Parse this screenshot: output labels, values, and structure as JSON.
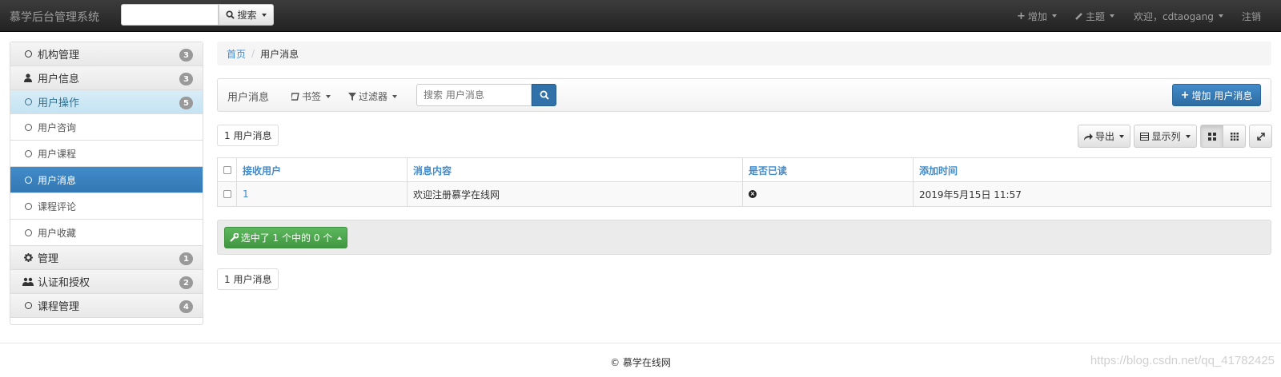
{
  "navbar": {
    "brand": "慕学后台管理系统",
    "search_value": "",
    "search_button": "搜索",
    "add_menu": "增加",
    "theme_menu": "主题",
    "user_menu": "欢迎，cdtaogang",
    "logout": "注销"
  },
  "sidebar": {
    "groups": [
      {
        "label": "机构管理",
        "badge": "3",
        "icon": "circle-icon"
      },
      {
        "label": "用户信息",
        "badge": "3",
        "icon": "user-icon"
      },
      {
        "label": "用户操作",
        "badge": "5",
        "icon": "circle-icon",
        "active": true
      },
      {
        "label": "管理",
        "badge": "1",
        "icon": "gear-icon"
      },
      {
        "label": "认证和授权",
        "badge": "2",
        "icon": "users-icon"
      },
      {
        "label": "课程管理",
        "badge": "4",
        "icon": "circle-icon"
      }
    ],
    "items": [
      {
        "label": "用户咨询"
      },
      {
        "label": "用户课程"
      },
      {
        "label": "用户消息",
        "selected": true
      },
      {
        "label": "课程评论"
      },
      {
        "label": "用户收藏"
      }
    ]
  },
  "breadcrumb": {
    "home": "首页",
    "separator": "/",
    "current": "用户消息"
  },
  "toolbar": {
    "title": "用户消息",
    "bookmarks": "书签",
    "filters": "过滤器",
    "search_placeholder": "搜索 用户消息",
    "add_button": "增加 用户消息"
  },
  "result_count_top": "1 用户消息",
  "result_count_bottom": "1 用户消息",
  "table_tools": {
    "export": "导出",
    "columns": "显示列"
  },
  "table": {
    "headers": [
      "接收用户",
      "消息内容",
      "是否已读",
      "添加时间"
    ],
    "rows": [
      {
        "user": "1",
        "message": "欢迎注册慕学在线网",
        "read": false,
        "time": "2019年5月15日 11:57"
      }
    ]
  },
  "action_bar": {
    "button": "选中了 1 个中的 0 个"
  },
  "footer": {
    "copyright": "© 慕学在线网",
    "watermark": "https://blog.csdn.net/qq_41782425"
  },
  "colors": {
    "primary": "#428bca",
    "success": "#5cb85c",
    "navbar": "#222222",
    "badge": "#999999"
  }
}
